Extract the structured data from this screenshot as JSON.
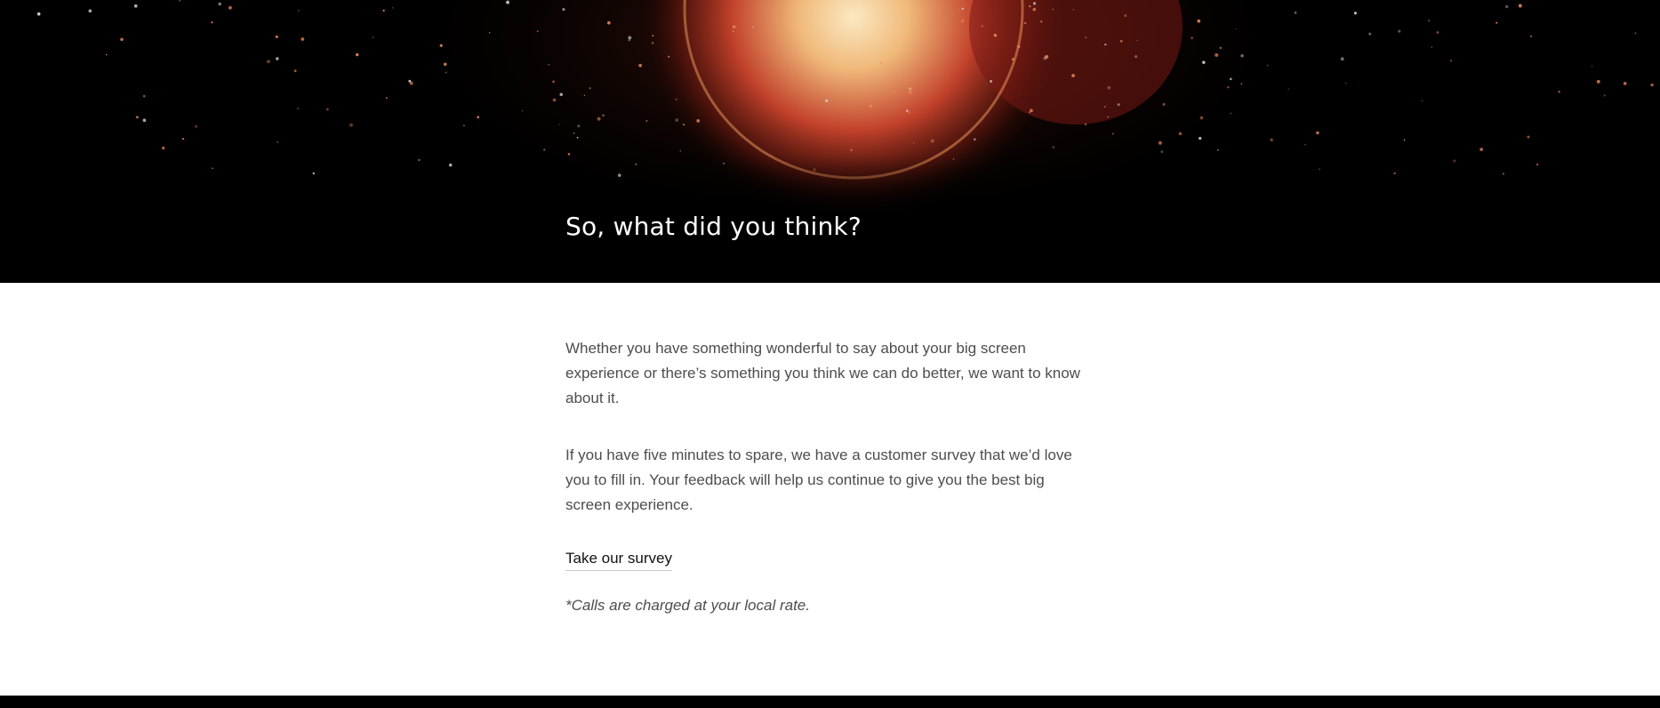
{
  "hero": {
    "title": "So, what did you think?"
  },
  "content": {
    "paragraphs": [
      "Whether you have something wonderful to say about your big screen experience or there’s something you think we can do better, we want to know about it.",
      "If you have five minutes to spare, we have a customer survey that we’d love you to fill in. Your feedback will help us continue to give you the best big screen experience."
    ],
    "survey_link": "Take our survey",
    "footnote": "*Calls are charged at your local rate."
  },
  "colors": {
    "hero_background": "#000000",
    "page_background": "#ffffff",
    "body_text": "#4d4d4d",
    "link_text": "#111111",
    "glow_core": "#f6d9a0",
    "glow_red": "#c2412b"
  },
  "icons": []
}
